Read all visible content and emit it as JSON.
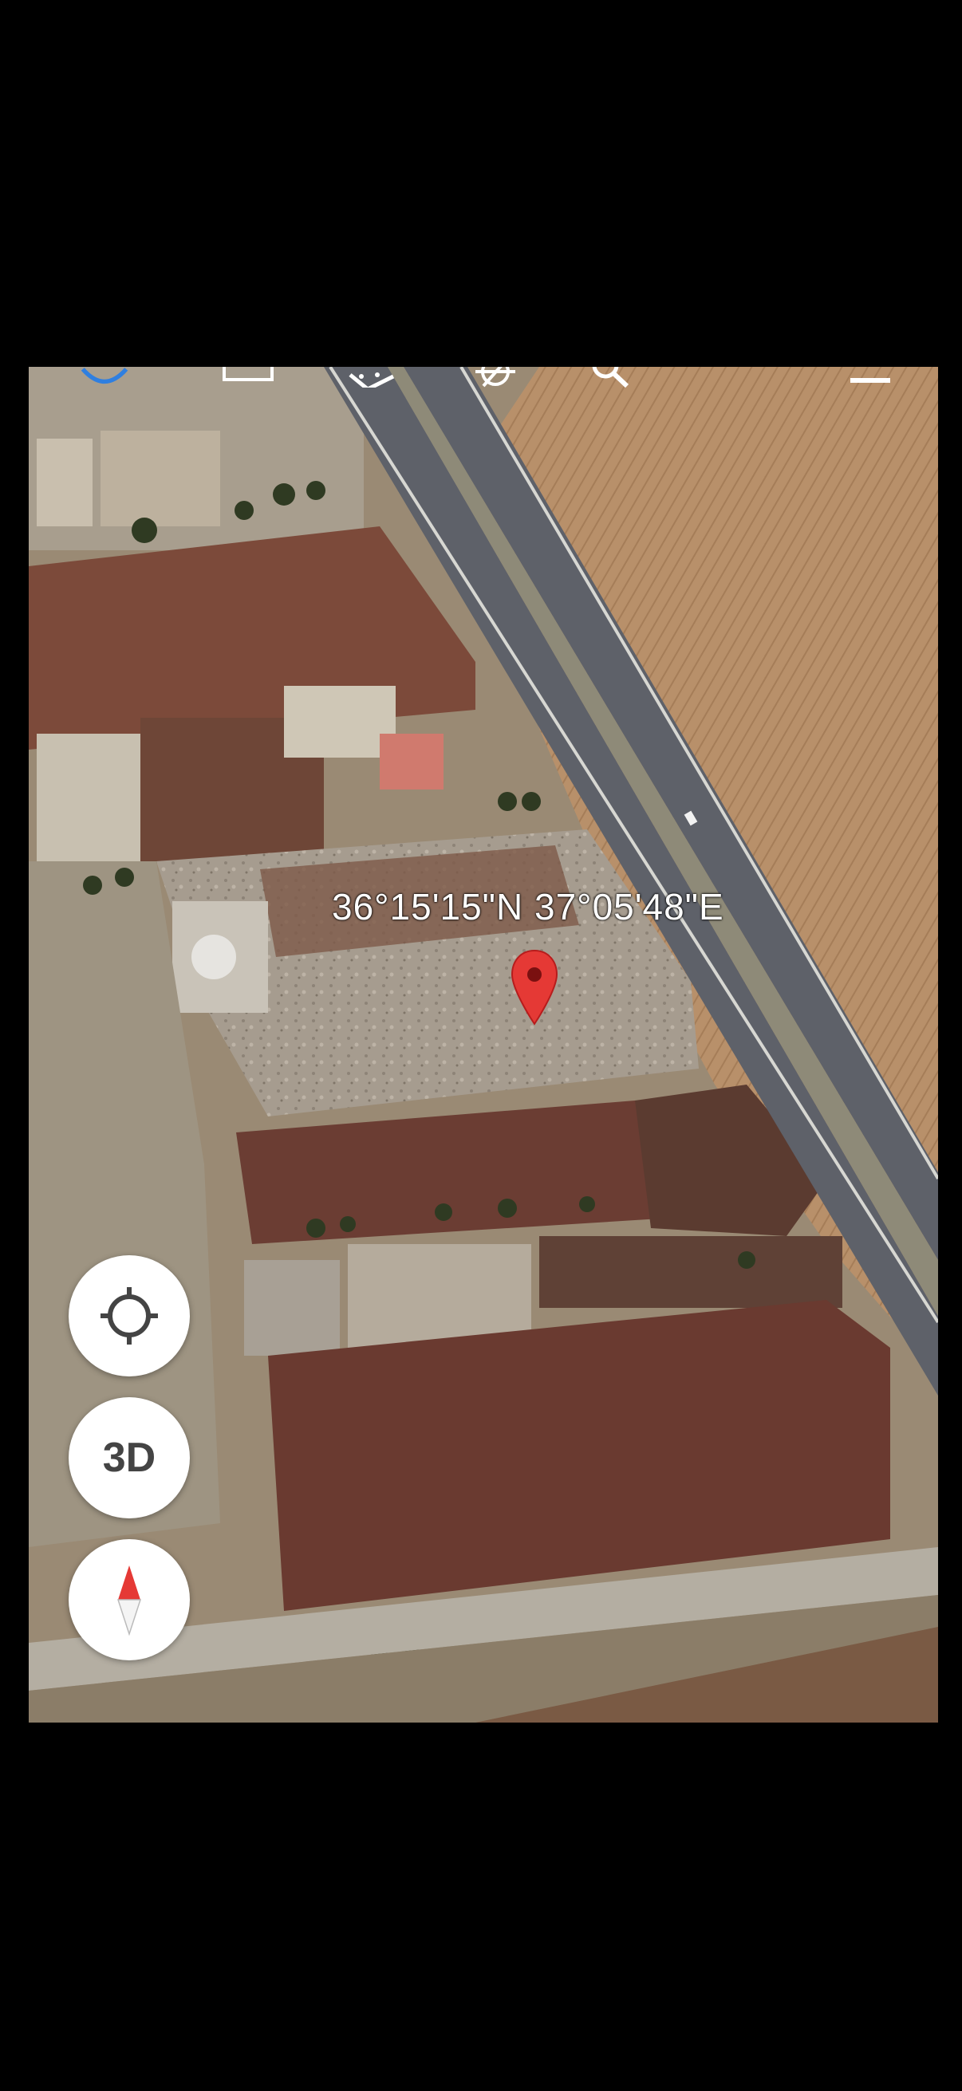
{
  "map": {
    "coordinates": "36°15'15\"N 37°05'48\"E",
    "marker_color": "#e53935"
  },
  "toolbar": {
    "icons": [
      "globe-icon",
      "layers-icon",
      "dice-icon",
      "ship-wheel-icon",
      "search-icon",
      "menu-icon"
    ]
  },
  "controls": {
    "locate_icon": "crosshair-icon",
    "view_3d_label": "3D",
    "compass_icon": "compass-icon"
  }
}
